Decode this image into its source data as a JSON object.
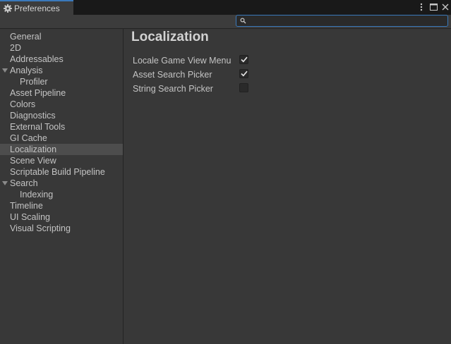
{
  "window": {
    "tab_title": "Preferences",
    "tab_icon": "gear-icon",
    "controls": [
      "more-options-icon",
      "maximize-icon",
      "close-icon"
    ]
  },
  "search": {
    "value": "",
    "placeholder": ""
  },
  "sidebar": {
    "items": [
      {
        "label": "General",
        "level": 0
      },
      {
        "label": "2D",
        "level": 0
      },
      {
        "label": "Addressables",
        "level": 0
      },
      {
        "label": "Analysis",
        "level": 0,
        "expanded": true
      },
      {
        "label": "Profiler",
        "level": 1
      },
      {
        "label": "Asset Pipeline",
        "level": 0
      },
      {
        "label": "Colors",
        "level": 0
      },
      {
        "label": "Diagnostics",
        "level": 0
      },
      {
        "label": "External Tools",
        "level": 0
      },
      {
        "label": "GI Cache",
        "level": 0
      },
      {
        "label": "Localization",
        "level": 0,
        "selected": true
      },
      {
        "label": "Scene View",
        "level": 0
      },
      {
        "label": "Scriptable Build Pipeline",
        "level": 0
      },
      {
        "label": "Search",
        "level": 0,
        "expanded": true
      },
      {
        "label": "Indexing",
        "level": 1
      },
      {
        "label": "Timeline",
        "level": 0
      },
      {
        "label": "UI Scaling",
        "level": 0
      },
      {
        "label": "Visual Scripting",
        "level": 0
      }
    ]
  },
  "main": {
    "title": "Localization",
    "settings": [
      {
        "label": "Locale Game View Menu",
        "checked": true
      },
      {
        "label": "Asset Search Picker",
        "checked": true
      },
      {
        "label": "String Search Picker",
        "checked": false
      }
    ]
  },
  "colors": {
    "accent": "#3a79bb",
    "background": "#383838",
    "selected_row": "#4d4d4d"
  }
}
